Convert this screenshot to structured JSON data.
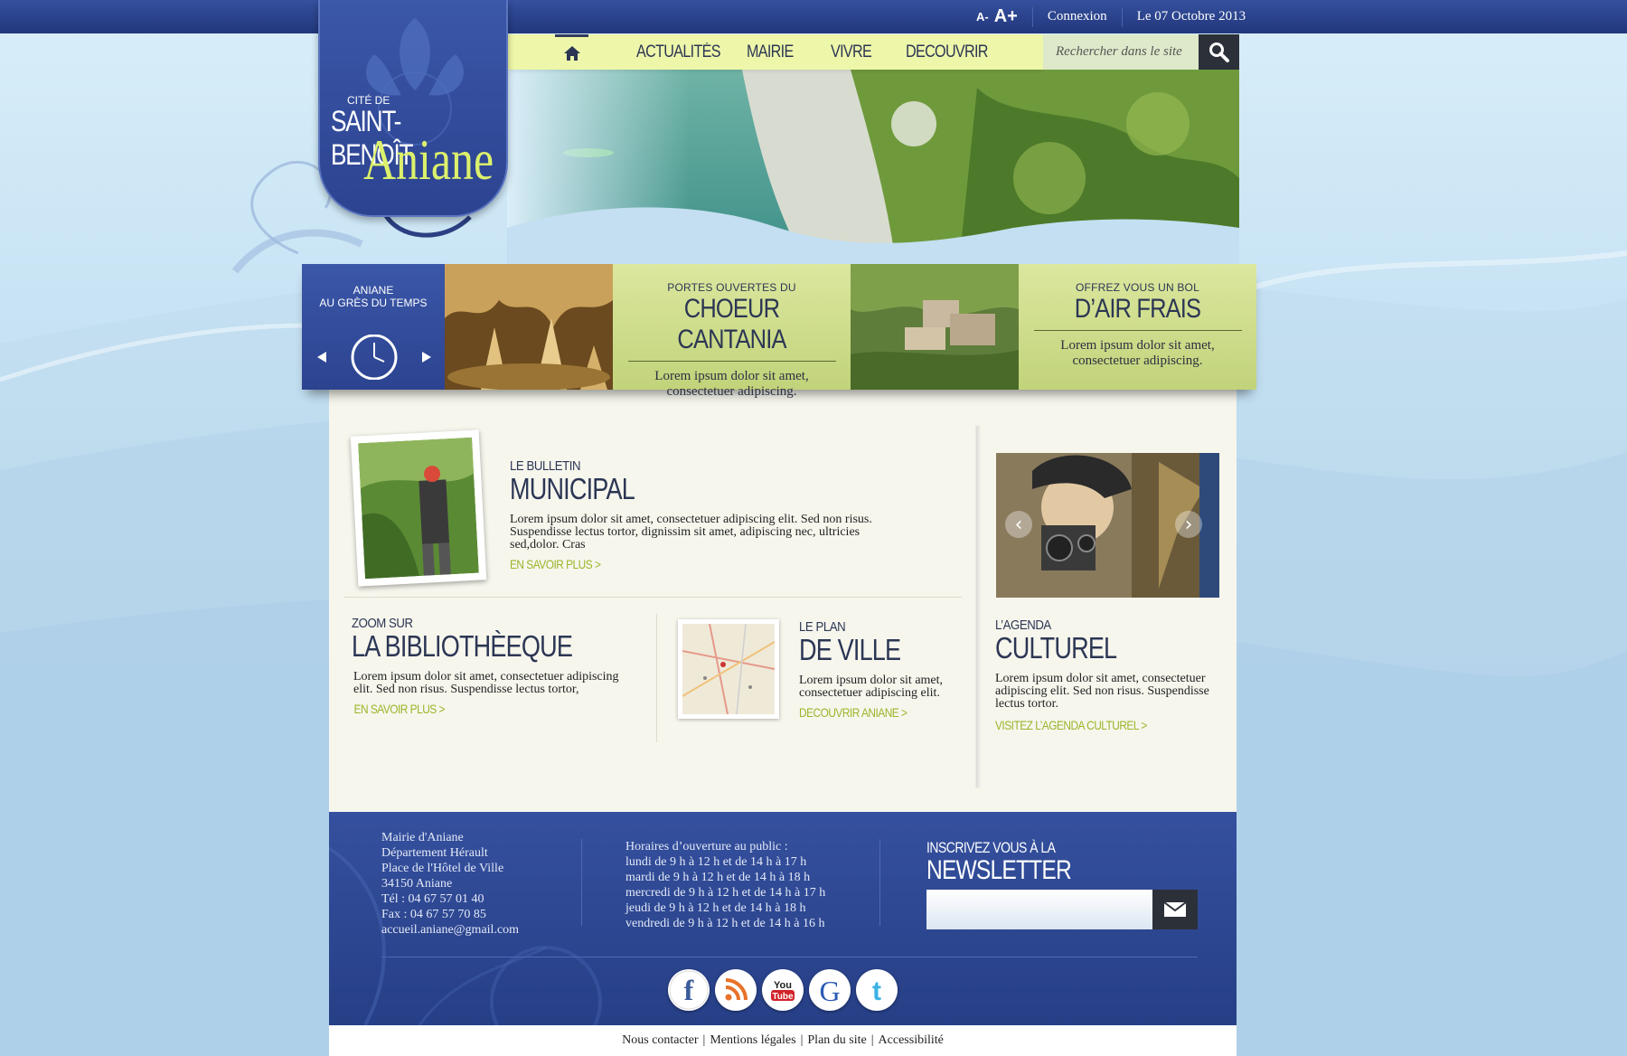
{
  "topbar": {
    "font_decrease": "A-",
    "font_increase": "A+",
    "login": "Connexion",
    "date": "Le 07 Octobre 2013"
  },
  "logo": {
    "cite": "CITÉ DE",
    "name": "SAINT-BENOÎT",
    "town": "Aniane"
  },
  "nav": {
    "home_icon": "home-icon",
    "items": [
      "ACTUALITÉS",
      "MAIRIE",
      "VIVRE",
      "DECOUVRIR"
    ],
    "search_placeholder": "Rechercher dans le site"
  },
  "strip": {
    "time_title_1": "ANIANE",
    "time_title_2": "AU GRÈS DU TEMPS",
    "promo1": {
      "kicker": "PORTES OUVERTES DU",
      "title": "CHOEUR CANTANIA",
      "text_1": "Lorem ipsum dolor sit amet,",
      "text_2": "consectetuer adipiscing."
    },
    "promo2": {
      "kicker": "OFFREZ VOUS UN BOL",
      "title": "D’AIR FRAIS",
      "text_1": "Lorem ipsum dolor sit amet,",
      "text_2": "consectetuer adipiscing."
    }
  },
  "bulletin": {
    "kicker": "LE BULLETIN",
    "title": "MUNICIPAL",
    "text": "Lorem ipsum dolor sit amet, consectetuer adipiscing elit. Sed non risus. Suspendisse lectus tortor, dignissim sit amet, adipiscing nec, ultricies sed,dolor. Cras",
    "link": "EN SAVOIR PLUS >"
  },
  "bibliotheque": {
    "kicker": "ZOOM SUR",
    "title": "LA BIBLIOTHÈEQUE",
    "text": "Lorem ipsum dolor sit amet, consectetuer adipiscing elit. Sed non risus. Suspendisse lectus tortor,",
    "link": "EN SAVOIR PLUS >"
  },
  "plan": {
    "kicker": "LE PLAN",
    "title": "DE VILLE",
    "text": "Lorem ipsum dolor sit amet, consectetuer adipiscing elit.",
    "link": "DECOUVRIR ANIANE >"
  },
  "agenda": {
    "kicker": "L’AGENDA",
    "title": "CULTUREL",
    "text": "Lorem ipsum dolor sit amet, consectetuer adipiscing elit. Sed non risus. Suspendisse lectus tortor.",
    "link": "VISITEZ L’AGENDA CULTUREL >"
  },
  "footer": {
    "address": [
      "Mairie d'Aniane",
      "Département Hérault",
      "Place de l'Hôtel de Ville",
      "34150 Aniane",
      "Tél : 04 67 57 01 40",
      "Fax : 04 67 57 70 85",
      "accueil.aniane@gmail.com"
    ],
    "hours": [
      "Horaires d’ouverture au public :",
      "lundi de 9 h à 12 h et de 14 h à 17 h",
      "mardi de 9 h à 12 h et de 14 h à 18 h",
      "mercredi de 9 h à 12 h et de 14 h à 17 h",
      "jeudi de 9 h à 12 h et de 14 h à 18 h",
      "vendredi de 9 h à 12 h et de 14 h à 16 h"
    ],
    "newsletter_kicker": "INSCRIVEZ VOUS À LA",
    "newsletter_title": "NEWSLETTER",
    "social": [
      "facebook-icon",
      "rss-icon",
      "youtube-icon",
      "google-icon",
      "twitter-icon"
    ]
  },
  "bottom_links": [
    "Nous contacter",
    "Mentions légales",
    "Plan du site",
    "Accessibilité"
  ],
  "colors": {
    "primary_blue": "#2c4390",
    "accent_lime": "#dcf06c",
    "link_green": "#9cb52a",
    "nav_bg": "#eef7a9"
  }
}
